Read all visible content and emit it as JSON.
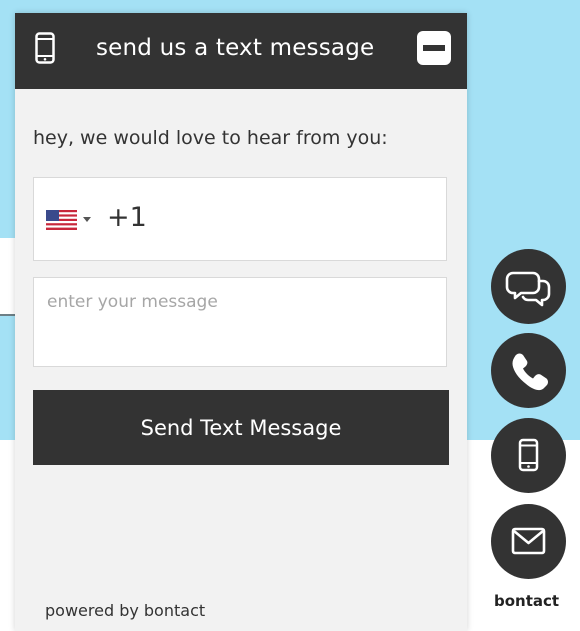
{
  "colors": {
    "page_background": "#a4e1f5",
    "header": "#333333",
    "button": "#333333",
    "panel": "#f2f2f2"
  },
  "widget": {
    "header": {
      "icon": "mobile-phone-icon",
      "title": "send us a text message",
      "minimize_icon": "minimize-icon"
    },
    "greeting": "hey, we would love to hear from you:",
    "phone": {
      "country_flag": "us-flag-icon",
      "dial_code": "+1"
    },
    "message": {
      "value": "",
      "placeholder": "enter your message"
    },
    "send_label": "Send Text Message",
    "powered_by": "powered by bontact"
  },
  "launcher": {
    "buttons": [
      {
        "icon": "chat-bubbles-icon"
      },
      {
        "icon": "phone-handset-icon"
      },
      {
        "icon": "mobile-phone-icon"
      },
      {
        "icon": "envelope-icon"
      }
    ],
    "brand": "bontact"
  }
}
